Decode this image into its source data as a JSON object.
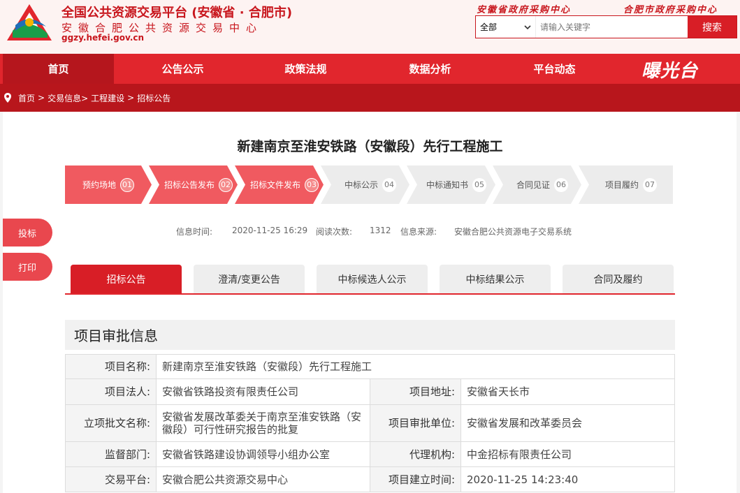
{
  "header": {
    "title": "全国公共资源交易平台 (安徽省 · 合肥市)",
    "subtitle": "安徽合肥公共资源交易中心",
    "url": "ggzy.hefei.gov.cn",
    "top_links": [
      "安徽省政府采购中心",
      "合肥市政府采购中心"
    ],
    "search": {
      "select_value": "全部",
      "placeholder": "请输入关键字",
      "button": "搜索"
    }
  },
  "nav": {
    "items": [
      "首页",
      "公告公示",
      "政策法规",
      "数据分析",
      "平台动态"
    ],
    "active": "首页",
    "logo_text": "曝光台"
  },
  "breadcrumb": [
    "首页",
    ">",
    "交易信息>",
    "工程建设",
    ">",
    "招标公告"
  ],
  "page_title": "新建南京至淮安铁路（安徽段）先行工程施工",
  "steps": [
    {
      "label": "预约场地",
      "num": "01",
      "done": true
    },
    {
      "label": "招标公告发布",
      "num": "02",
      "done": true
    },
    {
      "label": "招标文件发布",
      "num": "03",
      "done": true
    },
    {
      "label": "中标公示",
      "num": "04",
      "done": false
    },
    {
      "label": "中标通知书",
      "num": "05",
      "done": false
    },
    {
      "label": "合同见证",
      "num": "06",
      "done": false
    },
    {
      "label": "项目履约",
      "num": "07",
      "done": false
    }
  ],
  "meta": {
    "time_label": "信息时间:",
    "time_value": "2020-11-25 16:29",
    "reads_label": "阅读次数:",
    "reads_value": "1312",
    "source_label": "信息来源:",
    "source_value": "安徽合肥公共资源电子交易系统"
  },
  "side_buttons": [
    "投标",
    "打印"
  ],
  "tabs": [
    "招标公告",
    "澄清/变更公告",
    "中标候选人公示",
    "中标结果公示",
    "合同及履约"
  ],
  "active_tab": "招标公告",
  "section": {
    "title": "项目审批信息",
    "project_name_label": "项目名称:",
    "project_name": "新建南京至淮安铁路（安徽段）先行工程施工",
    "rows": [
      {
        "k1": "项目法人:",
        "v1": "安徽省铁路投资有限责任公司",
        "k2": "项目地址:",
        "v2": "安徽省天长市"
      },
      {
        "k1": "立项批文名称:",
        "v1": "安徽省发展改革委关于南京至淮安铁路（安徽段）可行性研究报告的批复",
        "k2": "项目审批单位:",
        "v2": "安徽省发展和改革委员会"
      },
      {
        "k1": "监督部门:",
        "v1": "安徽省铁路建设协调领导小组办公室",
        "k2": "代理机构:",
        "v2": "中金招标有限责任公司"
      },
      {
        "k1": "交易平台:",
        "v1": "安徽合肥公共资源交易中心",
        "k2": "项目建立时间:",
        "v2": "2020-11-25 14:23:40"
      }
    ]
  },
  "colors": {
    "brand_red": "#e1262d",
    "dark_red": "#b8161c",
    "step_done": "#f05a60",
    "step_todo": "#ececec"
  }
}
